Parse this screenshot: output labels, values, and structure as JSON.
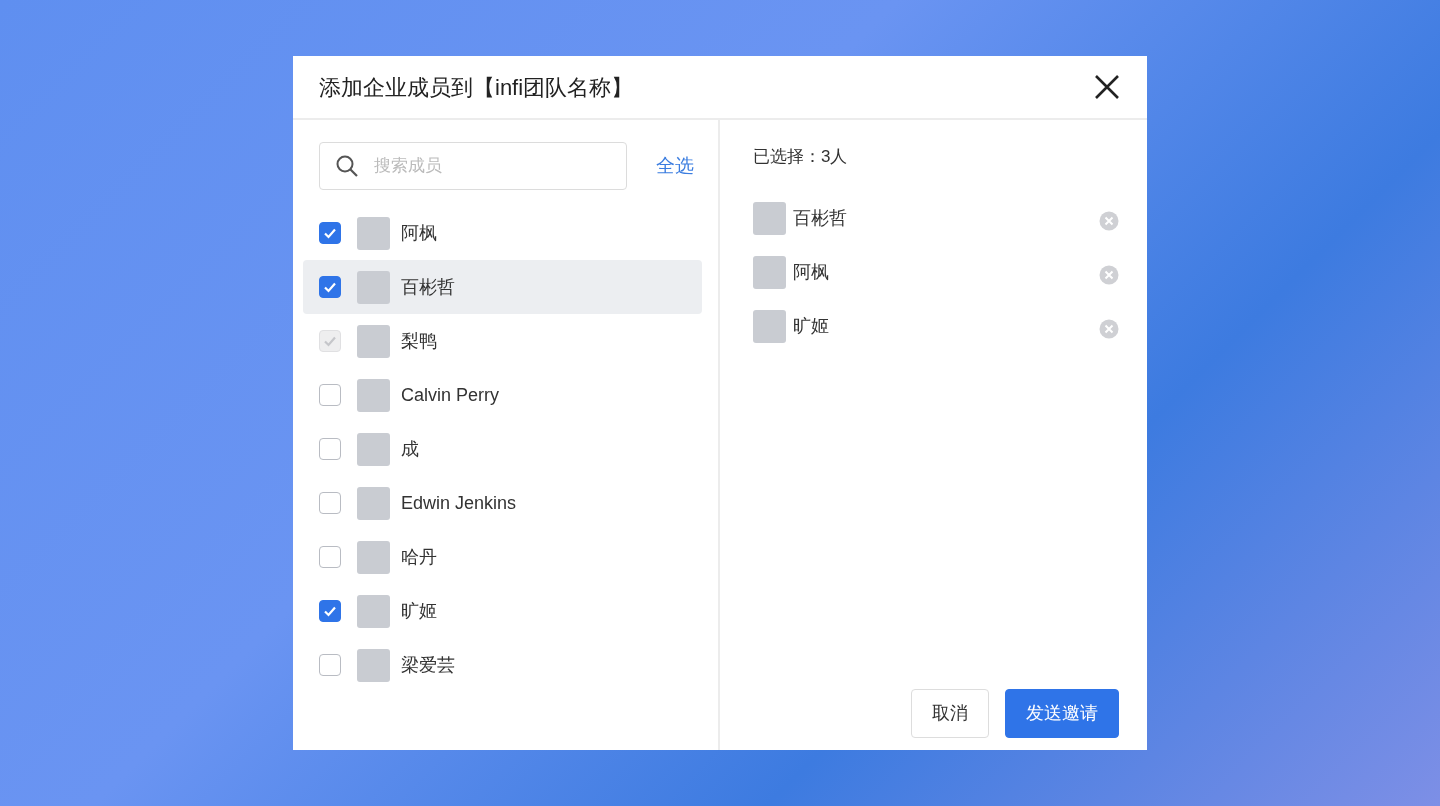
{
  "dialog": {
    "title": "添加企业成员到【infi团队名称】"
  },
  "search": {
    "placeholder": "搜索成员"
  },
  "select_all": "全选",
  "members": [
    {
      "name": "阿枫",
      "checked": true,
      "disabled": false,
      "selected": false
    },
    {
      "name": "百彬哲",
      "checked": true,
      "disabled": false,
      "selected": true
    },
    {
      "name": "梨鸭",
      "checked": true,
      "disabled": true,
      "selected": false
    },
    {
      "name": "Calvin Perry",
      "checked": false,
      "disabled": false,
      "selected": false
    },
    {
      "name": "成",
      "checked": false,
      "disabled": false,
      "selected": false
    },
    {
      "name": "Edwin Jenkins",
      "checked": false,
      "disabled": false,
      "selected": false
    },
    {
      "name": "哈丹",
      "checked": false,
      "disabled": false,
      "selected": false
    },
    {
      "name": "旷姬",
      "checked": true,
      "disabled": false,
      "selected": false
    },
    {
      "name": "梁爱芸",
      "checked": false,
      "disabled": false,
      "selected": false
    }
  ],
  "selected_summary": "已选择：3人",
  "selected_members": [
    {
      "name": "百彬哲"
    },
    {
      "name": "阿枫"
    },
    {
      "name": "旷姬"
    }
  ],
  "buttons": [
    {
      "label": "取消",
      "kind": "secondary"
    },
    {
      "label": "发送邀请",
      "kind": "primary"
    }
  ]
}
